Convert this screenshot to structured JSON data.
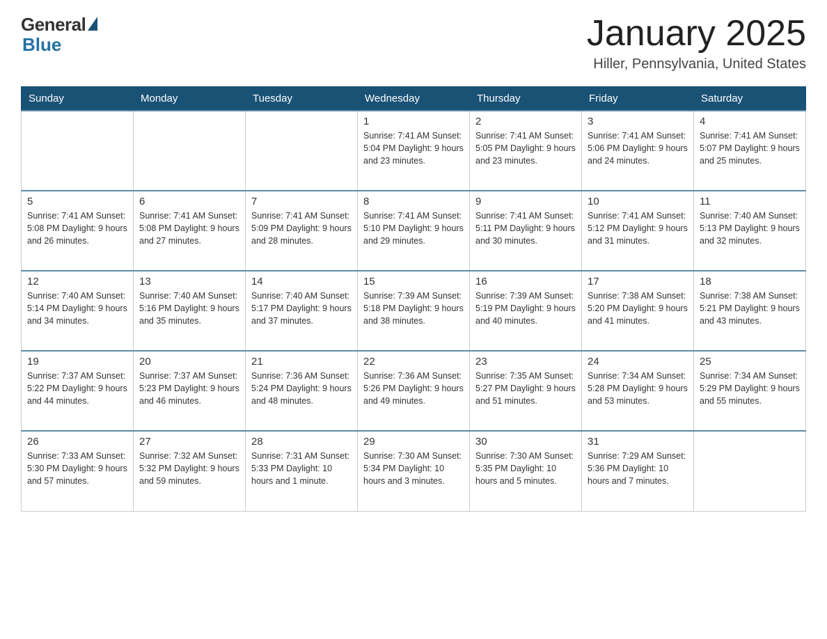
{
  "header": {
    "logo_general": "General",
    "logo_blue": "Blue",
    "title": "January 2025",
    "subtitle": "Hiller, Pennsylvania, United States"
  },
  "calendar": {
    "days_of_week": [
      "Sunday",
      "Monday",
      "Tuesday",
      "Wednesday",
      "Thursday",
      "Friday",
      "Saturday"
    ],
    "weeks": [
      [
        {
          "day": "",
          "info": ""
        },
        {
          "day": "",
          "info": ""
        },
        {
          "day": "",
          "info": ""
        },
        {
          "day": "1",
          "info": "Sunrise: 7:41 AM\nSunset: 5:04 PM\nDaylight: 9 hours\nand 23 minutes."
        },
        {
          "day": "2",
          "info": "Sunrise: 7:41 AM\nSunset: 5:05 PM\nDaylight: 9 hours\nand 23 minutes."
        },
        {
          "day": "3",
          "info": "Sunrise: 7:41 AM\nSunset: 5:06 PM\nDaylight: 9 hours\nand 24 minutes."
        },
        {
          "day": "4",
          "info": "Sunrise: 7:41 AM\nSunset: 5:07 PM\nDaylight: 9 hours\nand 25 minutes."
        }
      ],
      [
        {
          "day": "5",
          "info": "Sunrise: 7:41 AM\nSunset: 5:08 PM\nDaylight: 9 hours\nand 26 minutes."
        },
        {
          "day": "6",
          "info": "Sunrise: 7:41 AM\nSunset: 5:08 PM\nDaylight: 9 hours\nand 27 minutes."
        },
        {
          "day": "7",
          "info": "Sunrise: 7:41 AM\nSunset: 5:09 PM\nDaylight: 9 hours\nand 28 minutes."
        },
        {
          "day": "8",
          "info": "Sunrise: 7:41 AM\nSunset: 5:10 PM\nDaylight: 9 hours\nand 29 minutes."
        },
        {
          "day": "9",
          "info": "Sunrise: 7:41 AM\nSunset: 5:11 PM\nDaylight: 9 hours\nand 30 minutes."
        },
        {
          "day": "10",
          "info": "Sunrise: 7:41 AM\nSunset: 5:12 PM\nDaylight: 9 hours\nand 31 minutes."
        },
        {
          "day": "11",
          "info": "Sunrise: 7:40 AM\nSunset: 5:13 PM\nDaylight: 9 hours\nand 32 minutes."
        }
      ],
      [
        {
          "day": "12",
          "info": "Sunrise: 7:40 AM\nSunset: 5:14 PM\nDaylight: 9 hours\nand 34 minutes."
        },
        {
          "day": "13",
          "info": "Sunrise: 7:40 AM\nSunset: 5:16 PM\nDaylight: 9 hours\nand 35 minutes."
        },
        {
          "day": "14",
          "info": "Sunrise: 7:40 AM\nSunset: 5:17 PM\nDaylight: 9 hours\nand 37 minutes."
        },
        {
          "day": "15",
          "info": "Sunrise: 7:39 AM\nSunset: 5:18 PM\nDaylight: 9 hours\nand 38 minutes."
        },
        {
          "day": "16",
          "info": "Sunrise: 7:39 AM\nSunset: 5:19 PM\nDaylight: 9 hours\nand 40 minutes."
        },
        {
          "day": "17",
          "info": "Sunrise: 7:38 AM\nSunset: 5:20 PM\nDaylight: 9 hours\nand 41 minutes."
        },
        {
          "day": "18",
          "info": "Sunrise: 7:38 AM\nSunset: 5:21 PM\nDaylight: 9 hours\nand 43 minutes."
        }
      ],
      [
        {
          "day": "19",
          "info": "Sunrise: 7:37 AM\nSunset: 5:22 PM\nDaylight: 9 hours\nand 44 minutes."
        },
        {
          "day": "20",
          "info": "Sunrise: 7:37 AM\nSunset: 5:23 PM\nDaylight: 9 hours\nand 46 minutes."
        },
        {
          "day": "21",
          "info": "Sunrise: 7:36 AM\nSunset: 5:24 PM\nDaylight: 9 hours\nand 48 minutes."
        },
        {
          "day": "22",
          "info": "Sunrise: 7:36 AM\nSunset: 5:26 PM\nDaylight: 9 hours\nand 49 minutes."
        },
        {
          "day": "23",
          "info": "Sunrise: 7:35 AM\nSunset: 5:27 PM\nDaylight: 9 hours\nand 51 minutes."
        },
        {
          "day": "24",
          "info": "Sunrise: 7:34 AM\nSunset: 5:28 PM\nDaylight: 9 hours\nand 53 minutes."
        },
        {
          "day": "25",
          "info": "Sunrise: 7:34 AM\nSunset: 5:29 PM\nDaylight: 9 hours\nand 55 minutes."
        }
      ],
      [
        {
          "day": "26",
          "info": "Sunrise: 7:33 AM\nSunset: 5:30 PM\nDaylight: 9 hours\nand 57 minutes."
        },
        {
          "day": "27",
          "info": "Sunrise: 7:32 AM\nSunset: 5:32 PM\nDaylight: 9 hours\nand 59 minutes."
        },
        {
          "day": "28",
          "info": "Sunrise: 7:31 AM\nSunset: 5:33 PM\nDaylight: 10 hours\nand 1 minute."
        },
        {
          "day": "29",
          "info": "Sunrise: 7:30 AM\nSunset: 5:34 PM\nDaylight: 10 hours\nand 3 minutes."
        },
        {
          "day": "30",
          "info": "Sunrise: 7:30 AM\nSunset: 5:35 PM\nDaylight: 10 hours\nand 5 minutes."
        },
        {
          "day": "31",
          "info": "Sunrise: 7:29 AM\nSunset: 5:36 PM\nDaylight: 10 hours\nand 7 minutes."
        },
        {
          "day": "",
          "info": ""
        }
      ]
    ]
  }
}
